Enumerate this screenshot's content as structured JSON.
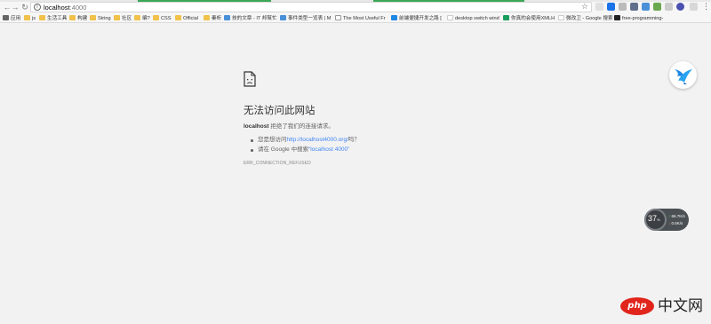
{
  "browser": {
    "url_host": "localhost",
    "url_port": ":4000",
    "back_icon": "arrow-left",
    "forward_icon": "arrow-right",
    "reload_icon": "reload",
    "star_icon": "star-outline",
    "menu_icon": "vertical-dots",
    "back_glyph": "←",
    "forward_glyph": "→",
    "reload_glyph": "↻",
    "star_glyph": "☆",
    "menu_glyph": "⋮",
    "info_glyph": "i"
  },
  "bookmarks": [
    {
      "label": "应用",
      "icon": "grid"
    },
    {
      "label": "js",
      "icon": "folder"
    },
    {
      "label": "生活工具",
      "icon": "folder"
    },
    {
      "label": "构建",
      "icon": "folder"
    },
    {
      "label": "String",
      "icon": "folder"
    },
    {
      "label": "社区",
      "icon": "folder"
    },
    {
      "label": "编?",
      "icon": "folder"
    },
    {
      "label": "CSS",
      "icon": "folder"
    },
    {
      "label": "Official",
      "icon": "folder"
    },
    {
      "label": "秦析",
      "icon": "folder"
    },
    {
      "label": "技的文章 - IT 邦幫忙",
      "icon": "blue-square"
    },
    {
      "label": "事件类型一览表 | M",
      "icon": "blue-square"
    },
    {
      "label": "The Most Useful Fr",
      "icon": "globe"
    },
    {
      "label": "前端便捷开发之路 [",
      "icon": "round-blue"
    },
    {
      "label": "desktop switch wind",
      "icon": "google"
    },
    {
      "label": "你真的会使用XMLH",
      "icon": "green"
    },
    {
      "label": "微改卫 - Google 搜索",
      "icon": "google"
    },
    {
      "label": "free-programming-",
      "icon": "github"
    }
  ],
  "error": {
    "title": "无法访问此网站",
    "host": "localhost",
    "message": " 拒绝了我们的连接请求。",
    "suggestion1_prefix": "您是想访问",
    "suggestion1_link": "http://localhost4000.org/",
    "suggestion1_suffix": "吗？",
    "suggestion2_prefix": "请在 Google 中搜索",
    "suggestion2_link": "“localhost 4000”",
    "code": "ERR_CONNECTION_REFUSED",
    "icon": "sad-document-icon"
  },
  "network_widget": {
    "percent": "37",
    "percent_unit": "%",
    "up": "66.7",
    "up_unit": "K/s",
    "down": "0.5",
    "down_unit": "K/s"
  },
  "watermark": {
    "php": "php",
    "text": "中文网"
  },
  "colors": {
    "link": "#4285f4",
    "page_bg": "#f2f2f2",
    "watermark_red": "#e1251b"
  }
}
